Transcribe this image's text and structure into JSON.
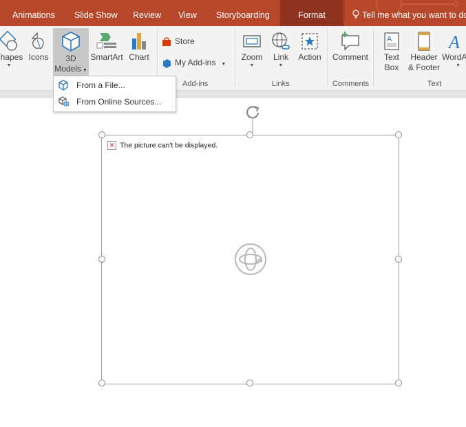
{
  "tabs": [
    {
      "label": "Animations",
      "active": false
    },
    {
      "label": "Slide Show",
      "active": false
    },
    {
      "label": "Review",
      "active": false
    },
    {
      "label": "View",
      "active": false
    },
    {
      "label": "Storyboarding",
      "active": false
    },
    {
      "label": "Format",
      "active": true
    }
  ],
  "tell_me": {
    "text": "Tell me what you want to do",
    "icon": "lightbulb-icon"
  },
  "ribbon": {
    "illustrations": {
      "shapes": "Shapes",
      "icons": "Icons",
      "models_line1": "3D",
      "models_line2": "Models",
      "smartart": "SmartArt",
      "chart": "Chart"
    },
    "addins": {
      "store": "Store",
      "my_addins": "My Add-ins",
      "group": "Add-ins"
    },
    "links": {
      "zoom": "Zoom",
      "link": "Link",
      "action": "Action",
      "group": "Links"
    },
    "comments": {
      "comment": "Comment",
      "group": "Comments"
    },
    "text": {
      "textbox_line1": "Text",
      "textbox_line2": "Box",
      "header_line1": "Header",
      "header_line2": "& Footer",
      "wordart": "WordArt",
      "group": "Text"
    }
  },
  "menu": {
    "items": [
      {
        "label": "From a File...",
        "icon": "cube-icon"
      },
      {
        "label": "From Online Sources...",
        "icon": "cube-globe-icon"
      }
    ]
  },
  "slide": {
    "broken_image_text": "The picture can't be displayed.",
    "placeholder_icon": "3d-rotate-icon"
  },
  "colors": {
    "tab_bar": "#b7472a",
    "active_tab": "#8f3320",
    "ribbon_bg": "#f3f3f3",
    "pressed": "#c8c8c8",
    "accent_blue": "#2b79c2",
    "store_red": "#d83b01"
  }
}
